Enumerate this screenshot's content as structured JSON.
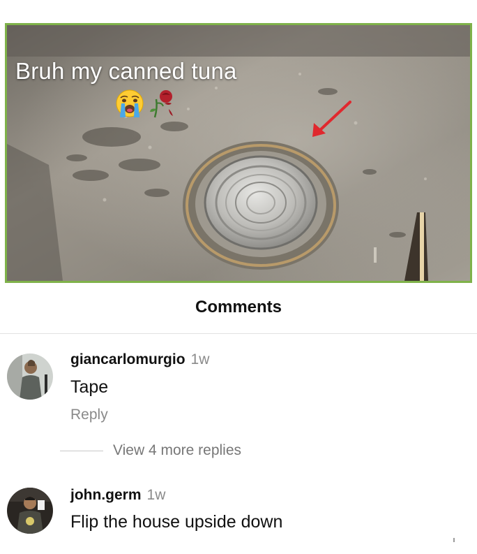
{
  "post": {
    "caption": "Bruh my canned tuna",
    "caption_emojis": [
      "crying-face",
      "wilted-rose"
    ],
    "arrow_color": "#e0282e",
    "border_color": "#7fb24a"
  },
  "comments_section": {
    "title": "Comments",
    "items": [
      {
        "username": "giancarlomurgio",
        "time": "1w",
        "text": "Tape",
        "reply_label": "Reply",
        "view_replies_label": "View 4 more replies"
      },
      {
        "username": "john.germ",
        "time": "1w",
        "text": "Flip the house upside down"
      }
    ]
  }
}
